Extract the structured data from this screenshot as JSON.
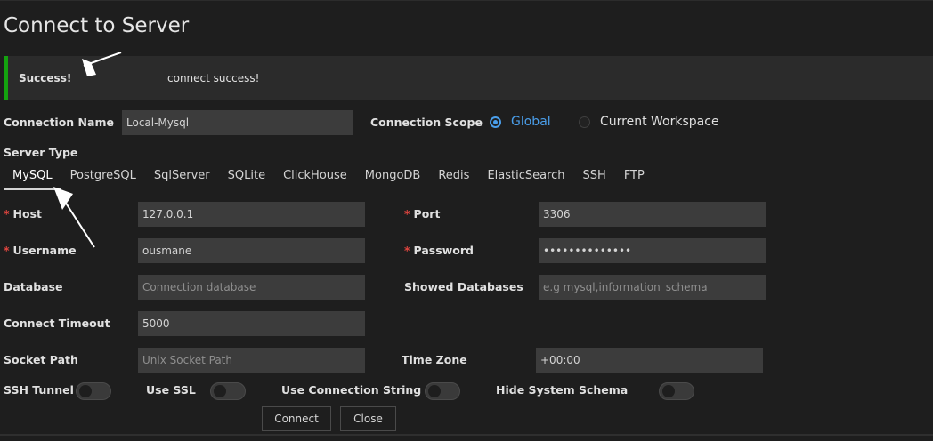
{
  "window": {
    "title": "Connect to Server"
  },
  "alert": {
    "title": "Success!",
    "message": "connect success!",
    "color": "#14a20f"
  },
  "connection_name": {
    "label": "Connection Name",
    "value": "Local-Mysql"
  },
  "connection_scope": {
    "label": "Connection Scope",
    "options": [
      {
        "label": "Global",
        "selected": true
      },
      {
        "label": "Current Workspace",
        "selected": false
      }
    ]
  },
  "server_type": {
    "label": "Server Type",
    "tabs": [
      "MySQL",
      "PostgreSQL",
      "SqlServer",
      "SQLite",
      "ClickHouse",
      "MongoDB",
      "Redis",
      "ElasticSearch",
      "SSH",
      "FTP"
    ],
    "active": "MySQL"
  },
  "fields": {
    "host": {
      "label": "Host",
      "required": "*",
      "value": "127.0.0.1"
    },
    "port": {
      "label": "Port",
      "required": "*",
      "value": "3306"
    },
    "username": {
      "label": "Username",
      "required": "*",
      "value": "ousmane"
    },
    "password": {
      "label": "Password",
      "required": "*",
      "value": "••••••••••••••"
    },
    "database": {
      "label": "Database",
      "placeholder": "Connection database"
    },
    "showed_databases": {
      "label": "Showed Databases",
      "placeholder": "e.g mysql,information_schema"
    },
    "connect_timeout": {
      "label": "Connect Timeout",
      "value": "5000"
    },
    "socket_path": {
      "label": "Socket Path",
      "placeholder": "Unix Socket Path"
    },
    "time_zone": {
      "label": "Time Zone",
      "value": "+00:00"
    }
  },
  "toggles": {
    "ssh_tunnel": {
      "label": "SSH Tunnel",
      "on": false
    },
    "use_ssl": {
      "label": "Use SSL",
      "on": false
    },
    "use_connection_string": {
      "label": "Use Connection String",
      "on": false
    },
    "hide_system_schema": {
      "label": "Hide System Schema",
      "on": false
    }
  },
  "buttons": {
    "connect": "Connect",
    "close": "Close"
  },
  "colors": {
    "accent": "#4a9eea",
    "background": "#1e1e1e",
    "input": "#3c3c3c",
    "required": "#e0453f"
  }
}
